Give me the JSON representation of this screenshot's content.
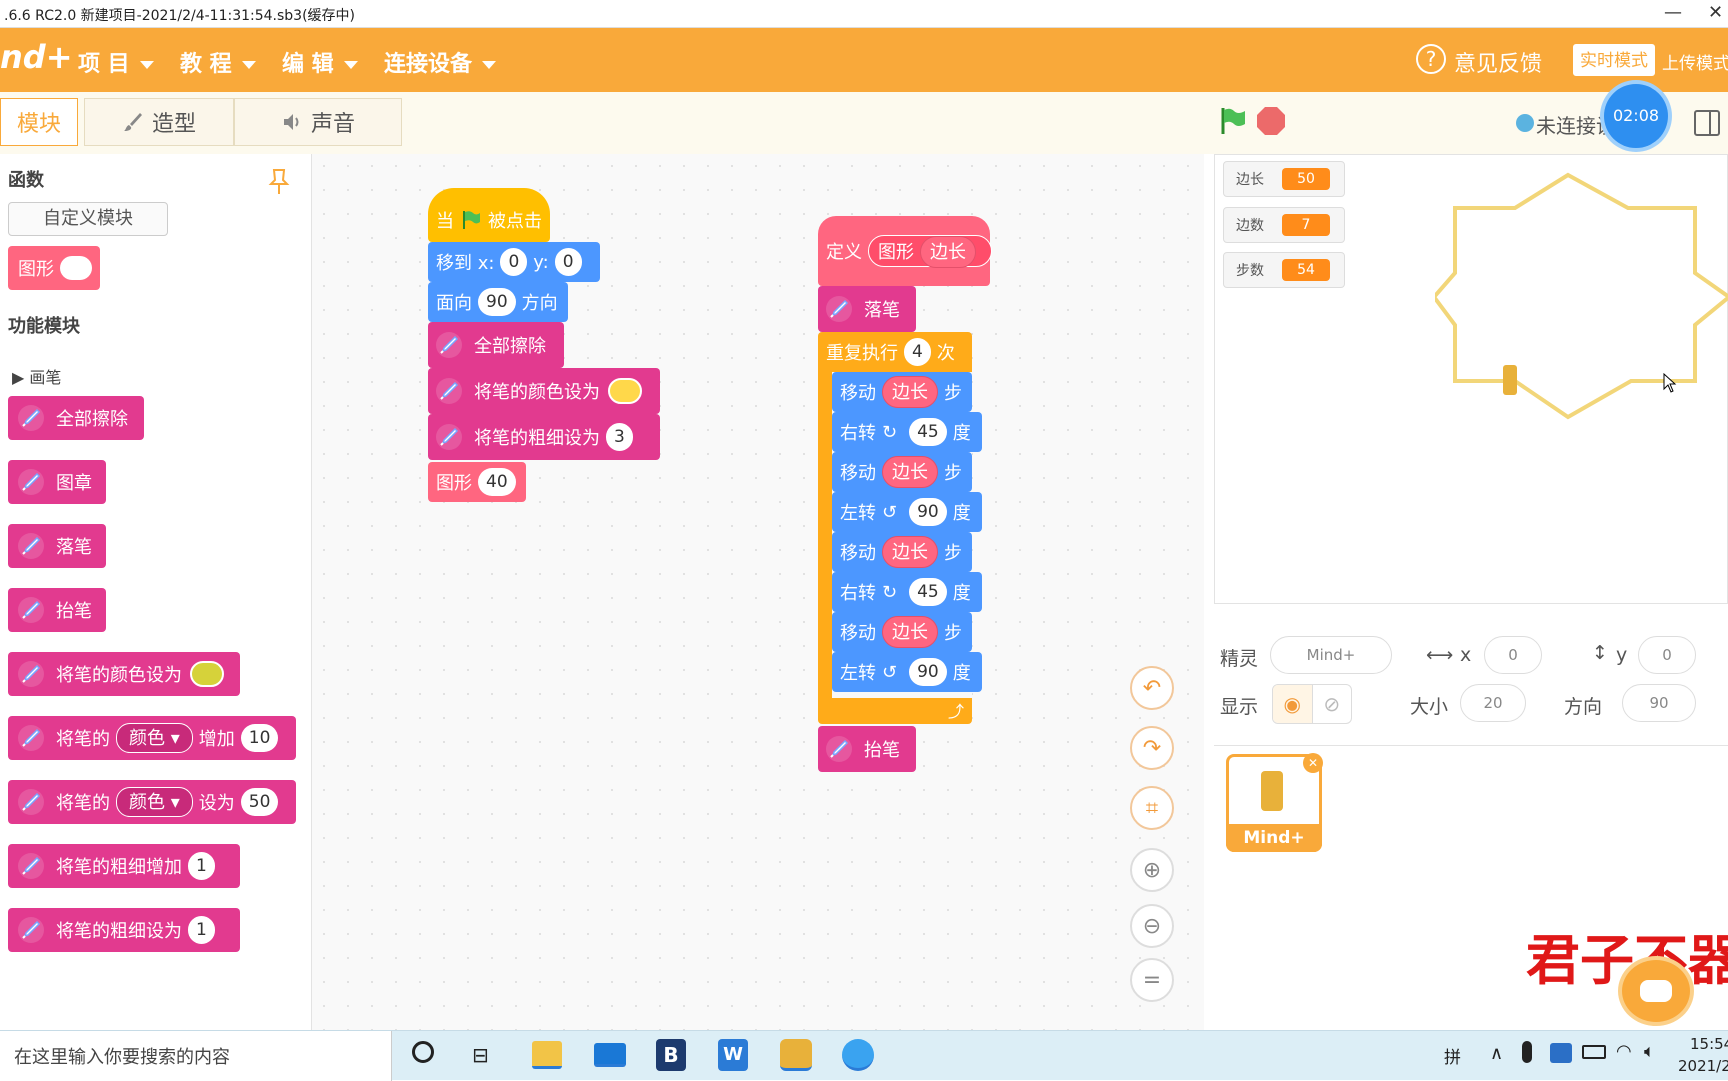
{
  "window": {
    "title": ".6.6 RC2.0   新建项目-2021/2/4-11:31:54.sb3(缓存中)",
    "minimize": "—",
    "close": "✕"
  },
  "menubar": {
    "logo": "nd+",
    "items": [
      "项 目",
      "教 程",
      "编 辑",
      "连接设备"
    ],
    "feedback": "意见反馈",
    "mode_live": "实时模式",
    "mode_upload": "上传模式"
  },
  "tabs": {
    "blocks": "模块",
    "costumes": "造型",
    "sounds": "声音"
  },
  "palette": {
    "functions_header": "函数",
    "custom_block_button": "自定义模块",
    "shape_block": "图形",
    "modules_header": "功能模块",
    "pen_category": "画笔",
    "blocks": {
      "clear": "全部擦除",
      "stamp": "图章",
      "pen_down": "落笔",
      "pen_up": "抬笔",
      "set_color": "将笔的颜色设为",
      "change_param": {
        "prefix": "将笔的",
        "dropdown": "颜色",
        "suffix": "增加",
        "value": "10"
      },
      "set_param": {
        "prefix": "将笔的",
        "dropdown": "颜色",
        "suffix": "设为",
        "value": "50"
      },
      "change_size": {
        "label": "将笔的粗细增加",
        "value": "1"
      },
      "set_size": {
        "label": "将笔的粗细设为",
        "value": "1"
      }
    }
  },
  "script1": {
    "hat": {
      "pre": "当",
      "post": "被点击"
    },
    "goto": {
      "label": "移到 x:",
      "x": "0",
      "ylabel": "y:",
      "y": "0"
    },
    "point": {
      "label": "面向",
      "value": "90",
      "suffix": "方向"
    },
    "clear": "全部擦除",
    "setcolor": "将笔的颜色设为",
    "setsize": {
      "label": "将笔的粗细设为",
      "value": "3"
    },
    "call": {
      "label": "图形",
      "value": "40"
    }
  },
  "script2": {
    "define": {
      "label": "定义",
      "name": "图形",
      "param": "边长"
    },
    "pen_down": "落笔",
    "repeat": {
      "label": "重复执行",
      "value": "4",
      "suffix": "次"
    },
    "move_label": "移动",
    "move_param": "边长",
    "move_suffix": "步",
    "right_label": "右转",
    "right_value": "45",
    "left_label": "左转",
    "left_value": "90",
    "deg": "度",
    "pen_up": "抬笔"
  },
  "stage": {
    "status": "未连接设",
    "timer": "02:08",
    "variables": [
      {
        "name": "边长",
        "value": "50"
      },
      {
        "name": "边数",
        "value": "7"
      },
      {
        "name": "步数",
        "value": "54"
      }
    ]
  },
  "sprite_info": {
    "sprite_label": "精灵",
    "sprite_name": "Mind+",
    "x_label": "x",
    "x": "0",
    "y_label": "y",
    "y": "0",
    "show_label": "显示",
    "size_label": "大小",
    "size": "20",
    "dir_label": "方向",
    "dir": "90"
  },
  "sprite_list": [
    {
      "name": "Mind+"
    }
  ],
  "overlay_text": "君子不器",
  "taskbar": {
    "search_placeholder": "在这里输入你要搜索的内容",
    "ime": "拼",
    "time": "15:54",
    "date": "2021/2"
  },
  "colors": {
    "accent": "#f9a93a",
    "pen": "#e23a8f",
    "motion": "#4c97ff",
    "custom": "#ff6680",
    "control": "#ffab19",
    "events": "#ffbf00"
  }
}
